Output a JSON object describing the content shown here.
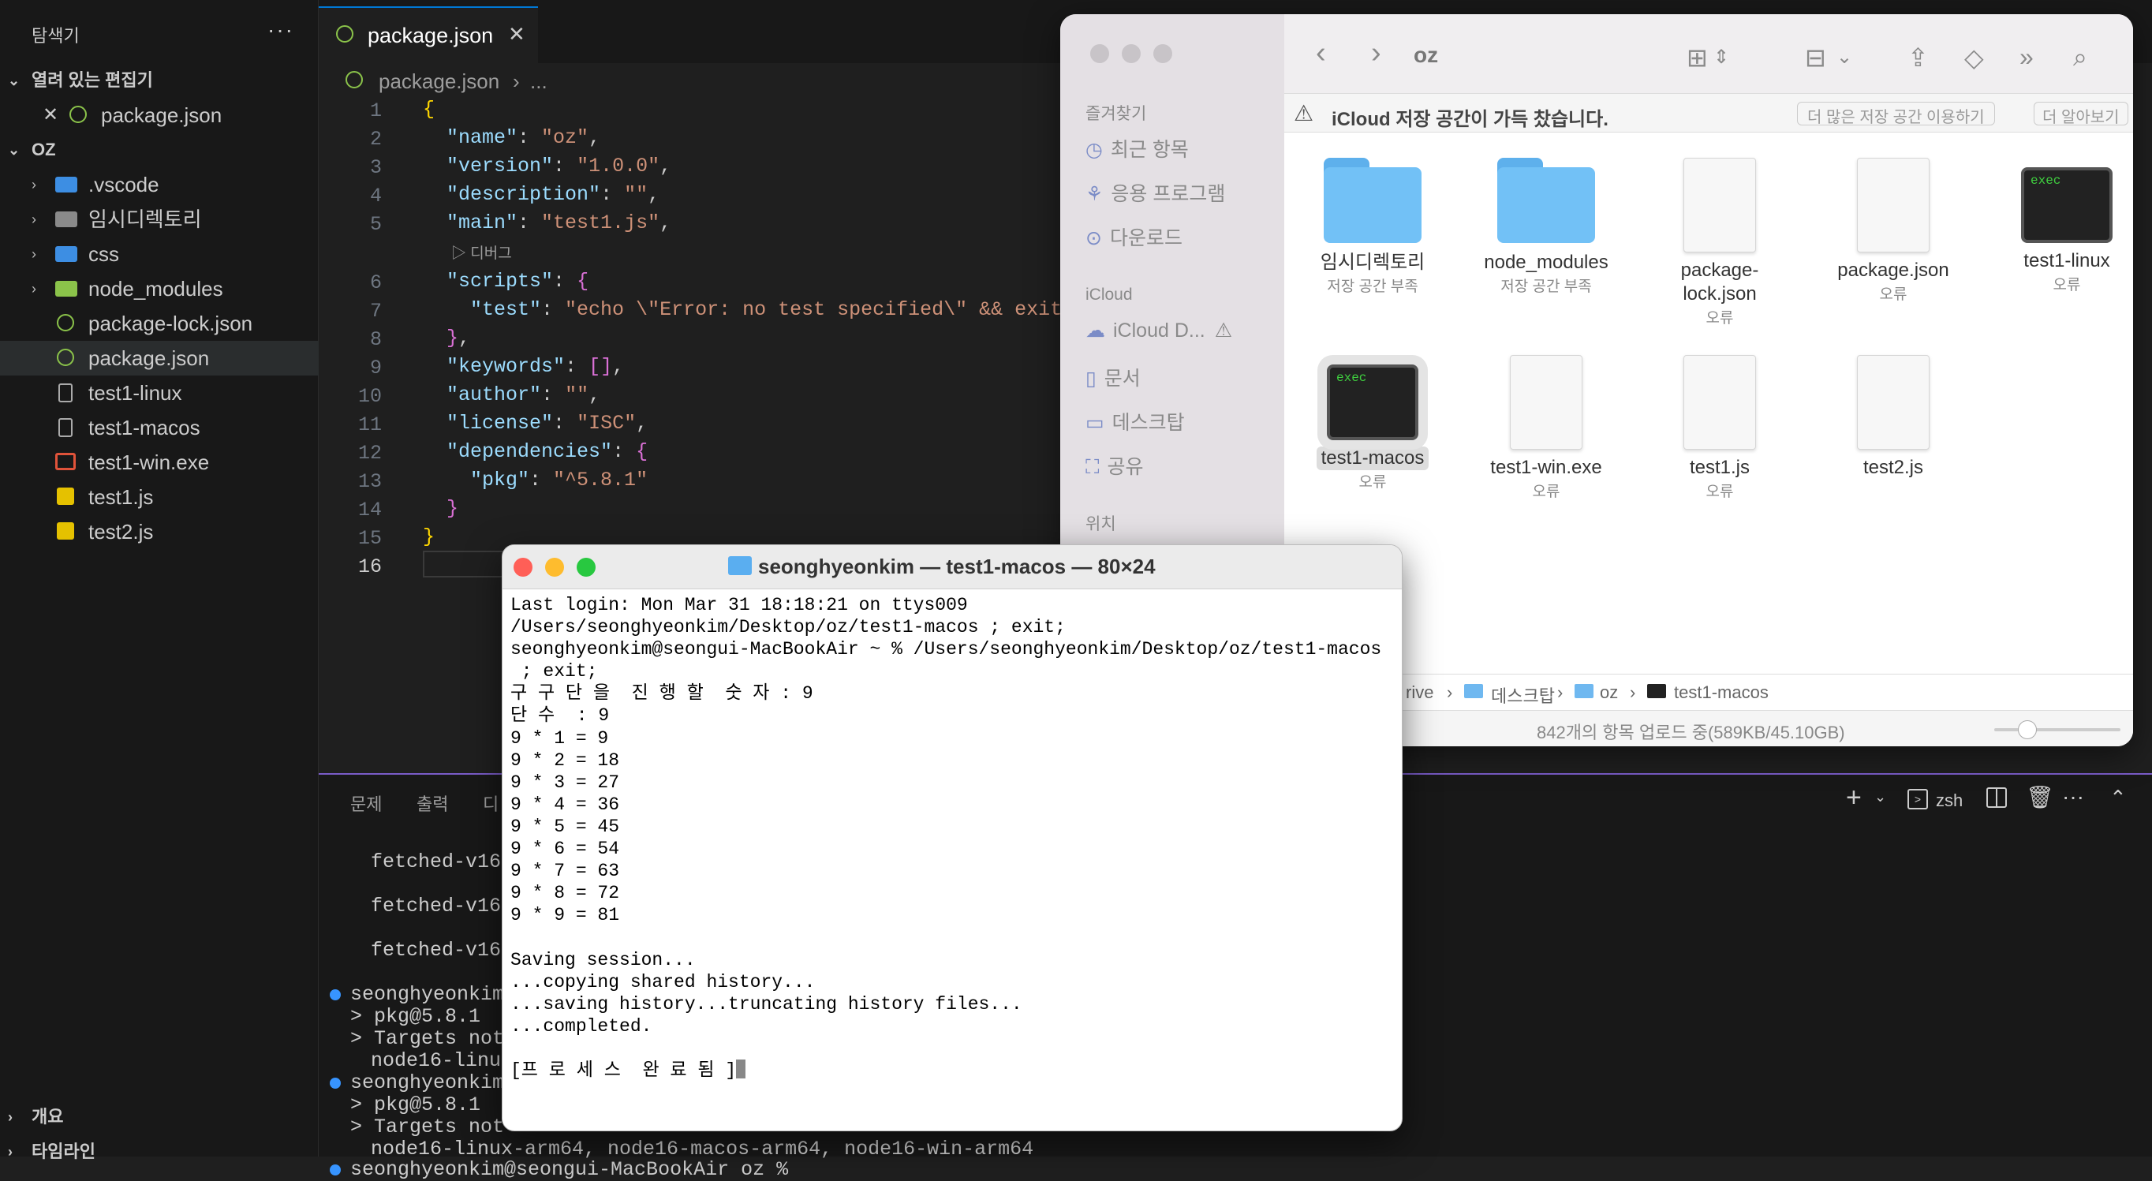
{
  "sidebar": {
    "title": "탐색기",
    "more": "···",
    "open_editors": "열려 있는 편집기",
    "open_file": "package.json",
    "root": "OZ",
    "items": [
      {
        "label": ".vscode",
        "kind": "folder",
        "color": "#3d8ee3"
      },
      {
        "label": "임시디렉토리",
        "kind": "folder",
        "color": "#8a8a8a"
      },
      {
        "label": "css",
        "kind": "folder",
        "color": "#3d8ee3"
      },
      {
        "label": "node_modules",
        "kind": "folder",
        "color": "#8bc34a"
      },
      {
        "label": "package-lock.json",
        "kind": "json",
        "color": "#8bc34a"
      },
      {
        "label": "package.json",
        "kind": "json",
        "color": "#8bc34a"
      },
      {
        "label": "test1-linux",
        "kind": "file",
        "color": "#aaa"
      },
      {
        "label": "test1-macos",
        "kind": "file",
        "color": "#aaa"
      },
      {
        "label": "test1-win.exe",
        "kind": "exe",
        "color": "#e0533a"
      },
      {
        "label": "test1.js",
        "kind": "js",
        "color": "#e5c100"
      },
      {
        "label": "test2.js",
        "kind": "js",
        "color": "#e5c100"
      }
    ],
    "outline": "개요",
    "timeline": "타임라인"
  },
  "editor": {
    "tab": "package.json",
    "breadcrumb_file": "package.json",
    "breadcrumb_rest": "...",
    "codelens": "디버그",
    "lines": [
      "1",
      "2",
      "3",
      "4",
      "5",
      "6",
      "7",
      "8",
      "9",
      "10",
      "11",
      "12",
      "13",
      "14",
      "15",
      "16"
    ]
  },
  "panel": {
    "tabs": [
      "문제",
      "출력",
      "디"
    ],
    "shell": "zsh",
    "lines": [
      "fetched-v16.",
      "fetched-v16.",
      "fetched-v16.",
      "seonghyeonkim@",
      "> pkg@5.8.1",
      "> Targets not",
      "node16-linux",
      "seonghyeonkim@",
      "> pkg@5.8.1",
      "> Targets not",
      "node16-linux-arm64, node16-macos-arm64, node16-win-arm64",
      "seonghyeonkim@seongui-MacBookAir oz % "
    ]
  },
  "finder": {
    "title": "oz",
    "favorites": "즐겨찾기",
    "fav_items": [
      "최근 항목",
      "응용 프로그램",
      "다운로드"
    ],
    "icloud": "iCloud",
    "icloud_items": [
      "iCloud D...",
      "문서",
      "데스크탑",
      "공유"
    ],
    "location": "위치",
    "banner": "iCloud 저장 공간이 가득 찼습니다.",
    "btn_more": "더 많은 저장 공간 이용하기",
    "btn_learn": "더 알아보기",
    "files": [
      {
        "name": "임시디렉토리",
        "status": "저장 공간 부족"
      },
      {
        "name": "node_modules",
        "status": "저장 공간 부족"
      },
      {
        "name": "package-\nlock.json",
        "status": "오류"
      },
      {
        "name": "package.json",
        "status": "오류"
      },
      {
        "name": "test1-linux",
        "status": "오류"
      },
      {
        "name": "test1-macos",
        "status": "오류"
      },
      {
        "name": "test1-win.exe",
        "status": "오류"
      },
      {
        "name": "test1.js",
        "status": "오류"
      },
      {
        "name": "test2.js",
        "status": ""
      }
    ],
    "exec_label": "exec",
    "path": [
      "rive",
      "데스크탑",
      "oz",
      "test1-macos"
    ],
    "statusbar": "842개의 항목 업로드 중(589KB/45.10GB)"
  },
  "terminal": {
    "title": "seonghyeonkim — test1-macos — 80×24",
    "text": "Last login: Mon Mar 31 18:18:21 on ttys009\n/Users/seonghyeonkim/Desktop/oz/test1-macos ; exit;\nseonghyeonkim@seongui-MacBookAir ~ % /Users/seonghyeonkim/Desktop/oz/test1-macos\n ; exit;\n구 구 단 을  진 행 할  숫 자 : 9\n단 수  : 9\n9 * 1 = 9\n9 * 2 = 18\n9 * 3 = 27\n9 * 4 = 36\n9 * 5 = 45\n9 * 6 = 54\n9 * 7 = 63\n9 * 8 = 72\n9 * 9 = 81\n\nSaving session...\n...copying shared history...\n...saving history...truncating history files...\n...completed.\n\n[프 로 세 스  완 료 됨 ]"
  }
}
